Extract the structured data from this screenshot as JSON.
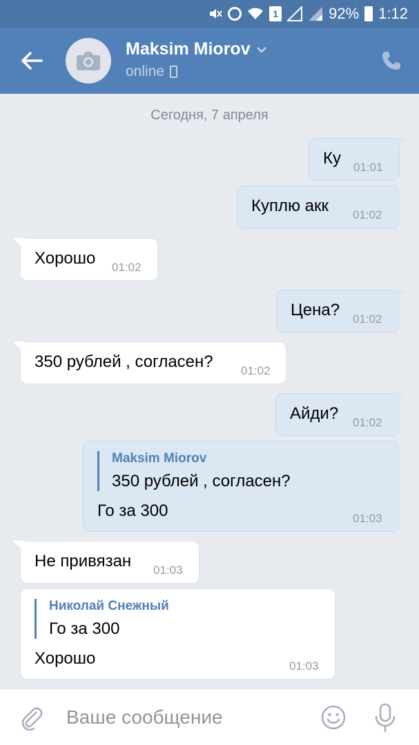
{
  "status_bar": {
    "battery": "92%",
    "time": "1:12",
    "sim_label": "1"
  },
  "header": {
    "contact_name": "Maksim Miorov",
    "status": "online"
  },
  "chat": {
    "date": "Сегодня, 7 апреля",
    "messages": [
      {
        "text": "Ку",
        "time": "01:01"
      },
      {
        "text": "Куплю акк",
        "time": "01:02"
      },
      {
        "text": "Хорошо",
        "time": "01:02"
      },
      {
        "text": "Цена?",
        "time": "01:02"
      },
      {
        "text": "350 рублей , согласен?",
        "time": "01:02"
      },
      {
        "text": "Айди?",
        "time": "01:02"
      },
      {
        "reply_name": "Maksim Miorov",
        "reply_text": "350 рублей , согласен?",
        "text": "Го за 300",
        "time": "01:03"
      },
      {
        "text": "Не привязан",
        "time": "01:03"
      },
      {
        "reply_name": "Николай Снежный",
        "reply_text": "Го за 300",
        "text": "Хорошо",
        "time": "01:03"
      }
    ]
  },
  "composer": {
    "placeholder": "Ваше сообщение"
  },
  "colors": {
    "header": "#5181b8",
    "status_bar": "#4a76a8",
    "outgoing_bubble": "#dce7f4",
    "incoming_bubble": "#ffffff",
    "chat_background": "#e7ebf0"
  }
}
